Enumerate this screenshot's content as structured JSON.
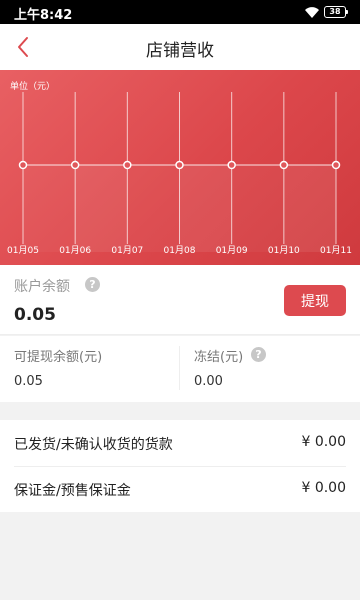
{
  "status_bar": {
    "time": "上午8:42",
    "battery": "38"
  },
  "nav": {
    "title": "店铺营收"
  },
  "chart_data": {
    "type": "line",
    "unit_label": "单位（元）",
    "categories": [
      "01月05",
      "01月06",
      "01月07",
      "01月08",
      "01月09",
      "01月10",
      "01月11"
    ],
    "values": [
      0,
      0,
      0,
      0,
      0,
      0,
      0
    ],
    "ylim": [
      0,
      1
    ],
    "grid": true
  },
  "account": {
    "label": "账户余额",
    "amount": "0.05",
    "withdraw_label": "提现"
  },
  "sub": {
    "withdrawable_label": "可提现余额(元)",
    "withdrawable_value": "0.05",
    "frozen_label": "冻结(元)",
    "frozen_value": "0.00"
  },
  "details": [
    {
      "label": "已发货/未确认收货的货款",
      "value": "¥ 0.00"
    },
    {
      "label": "保证金/预售保证金",
      "value": "¥ 0.00"
    }
  ],
  "colors": {
    "accent": "#dd4a4f",
    "chart_top": "#e86063",
    "chart_bottom": "#cf3a3e"
  }
}
